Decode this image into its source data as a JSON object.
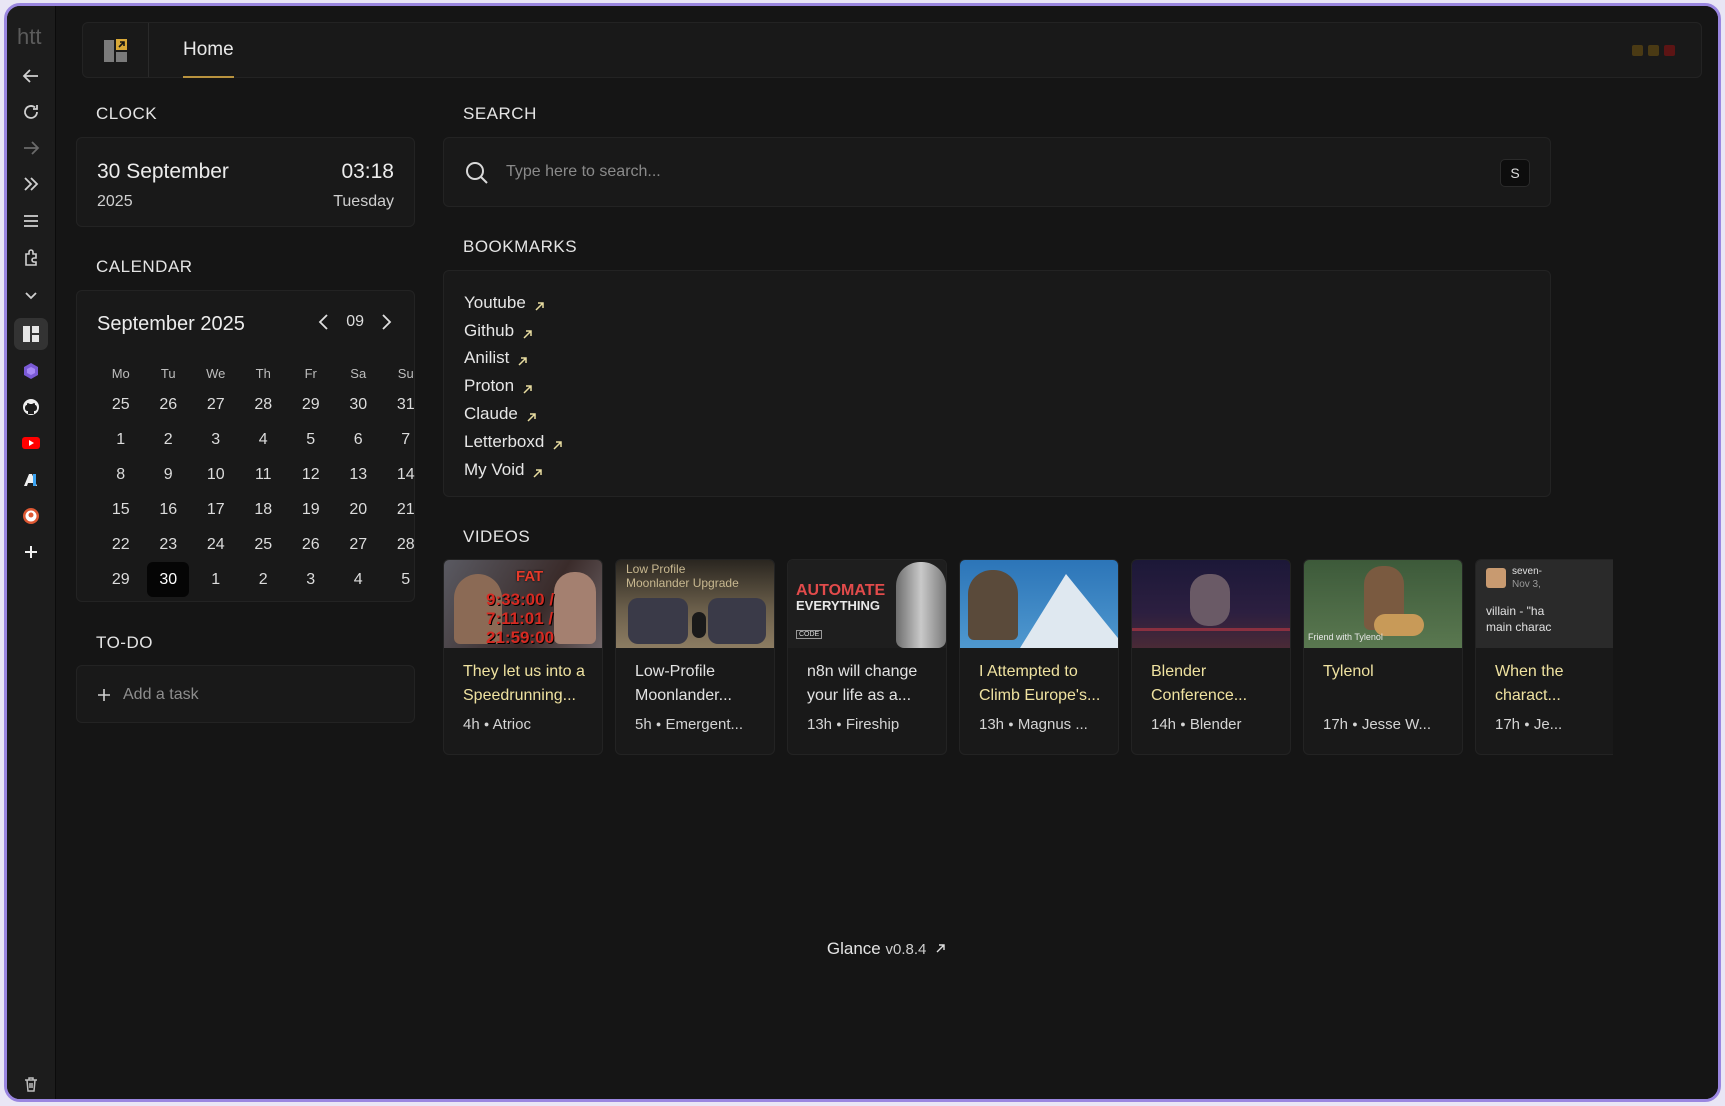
{
  "rail": {
    "url_text": "htt",
    "icons": [
      "back-arrow-icon",
      "reload-icon",
      "forward-arrow-icon",
      "double-chevron-icon",
      "menu-icon",
      "puzzle-icon",
      "chevron-down-icon",
      "glance-app-icon",
      "hexagon-app-icon",
      "github-icon",
      "youtube-icon",
      "anilist-icon",
      "duckduckgo-icon",
      "plus-icon",
      "trash-icon"
    ]
  },
  "header": {
    "tab_home": "Home",
    "dot_colors": [
      "#4a3a14",
      "#4a3a14",
      "#5c1414"
    ]
  },
  "clock": {
    "title": "CLOCK",
    "date": "30 September",
    "year": "2025",
    "time": "03:18",
    "weekday": "Tuesday"
  },
  "calendar": {
    "title": "CALENDAR",
    "month_label": "September 2025",
    "month_num": "09",
    "weekdays": [
      "Mo",
      "Tu",
      "We",
      "Th",
      "Fr",
      "Sa",
      "Su"
    ],
    "days": [
      "25",
      "26",
      "27",
      "28",
      "29",
      "30",
      "31",
      "1",
      "2",
      "3",
      "4",
      "5",
      "6",
      "7",
      "8",
      "9",
      "10",
      "11",
      "12",
      "13",
      "14",
      "15",
      "16",
      "17",
      "18",
      "19",
      "20",
      "21",
      "22",
      "23",
      "24",
      "25",
      "26",
      "27",
      "28",
      "29",
      "30",
      "1",
      "2",
      "3",
      "4",
      "5"
    ],
    "today_index": 36
  },
  "todo": {
    "title": "TO-DO",
    "add_placeholder": "Add a task"
  },
  "search": {
    "title": "SEARCH",
    "placeholder": "Type here to search...",
    "shortcut_key": "S"
  },
  "bookmarks": {
    "title": "BOOKMARKS",
    "items": [
      "Youtube",
      "Github",
      "Anilist",
      "Proton",
      "Claude",
      "Letterboxd",
      "My Void"
    ]
  },
  "videos": {
    "title": "VIDEOS",
    "items": [
      {
        "title": "They let us into a Speedrunning...",
        "meta_time": "4h",
        "meta_channel": "Atrioc",
        "highlight": true
      },
      {
        "title": "Low-Profile Moonlander...",
        "meta_time": "5h",
        "meta_channel": "Emergent...",
        "highlight": false
      },
      {
        "title": "n8n will change your life as a...",
        "meta_time": "13h",
        "meta_channel": "Fireship",
        "highlight": false
      },
      {
        "title": "I Attempted to Climb Europe's...",
        "meta_time": "13h",
        "meta_channel": "Magnus ...",
        "highlight": true
      },
      {
        "title": "Blender Conference...",
        "meta_time": "14h",
        "meta_channel": "Blender",
        "highlight": true
      },
      {
        "title": "Tylenol",
        "meta_time": "17h",
        "meta_channel": "Jesse W...",
        "highlight": true
      },
      {
        "title": "When the charact...",
        "meta_time": "17h",
        "meta_channel": "Je...",
        "highlight": true
      }
    ],
    "thumb_text": {
      "t1_overlay": "9:33:00 / 7:11:01 / 21:59:00",
      "t1_tag": "FAT",
      "t2_line1": "Low Profile",
      "t2_line2": "Moonlander Upgrade",
      "t3_line1": "AUTOMATE",
      "t3_line2": "EVERYTHING",
      "t3_badge": "CODE",
      "t6_caption": "Friend with Tylenol",
      "t7_user": "seven-",
      "t7_date": "Nov 3,",
      "t7_line1": "villain - \"ha",
      "t7_line2": "main charac"
    }
  },
  "footer": {
    "brand": "Glance",
    "version": "v0.8.4"
  }
}
